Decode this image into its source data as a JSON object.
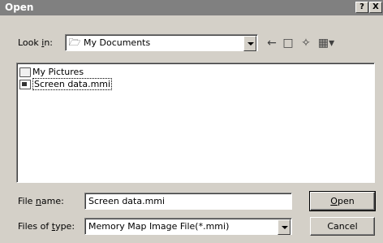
{
  "dialog": {
    "title": "Open",
    "help_label": "?",
    "close_label": "X"
  },
  "look_in": {
    "label_pre": "Look ",
    "label_accel": "i",
    "label_post": "n:",
    "value": "My Documents"
  },
  "toolbar": {
    "icons": [
      "back-icon",
      "up-folder-icon",
      "new-folder-icon",
      "view-menu-icon"
    ]
  },
  "file_list": {
    "items": [
      {
        "name": "My Pictures",
        "icon": "folder-icon"
      },
      {
        "name": "Screen data.mmi",
        "icon": "file-icon"
      }
    ]
  },
  "file_name": {
    "label_pre": "File ",
    "label_accel": "n",
    "label_post": "ame:",
    "value": "Screen data.mmi"
  },
  "file_type": {
    "label_pre": "Files of ",
    "label_accel": "t",
    "label_post": "ype:",
    "value": "Memory Map Image File(*.mmi)"
  },
  "buttons": {
    "open_accel": "O",
    "open_rest": "pen",
    "cancel_label": "Cancel"
  }
}
